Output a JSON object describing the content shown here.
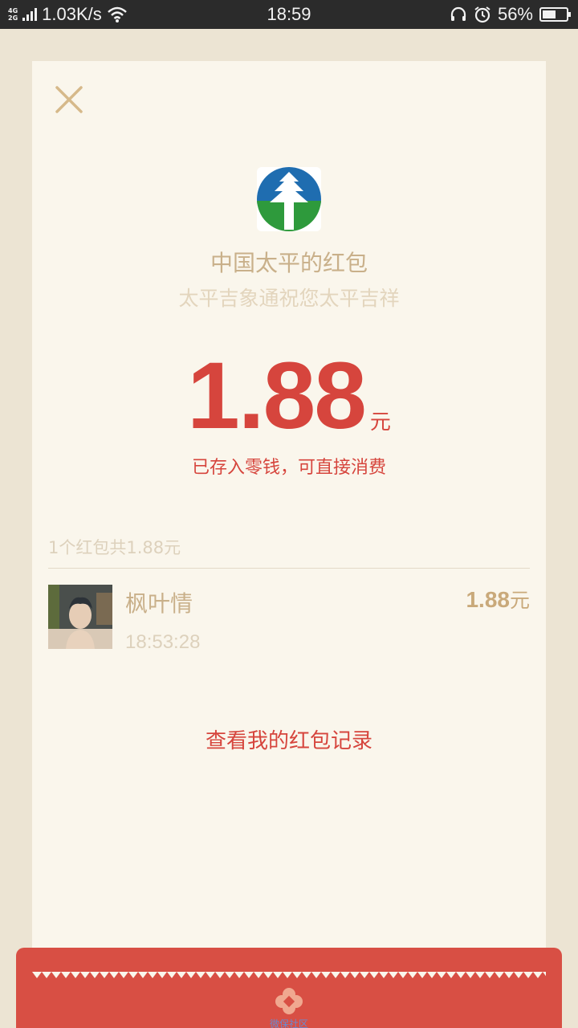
{
  "status_bar": {
    "network_types": [
      "4G",
      "2G"
    ],
    "speed": "1.03K/s",
    "time": "18:59",
    "battery_pct": "56%",
    "battery_level": 0.56,
    "icons": [
      "signal-icon",
      "wifi-icon",
      "headset-icon",
      "alarm-icon",
      "battery-icon"
    ]
  },
  "packet": {
    "sender": "中国太平的红包",
    "blessing": "太平吉象通祝您太平吉祥",
    "amount": "1.88",
    "unit": "元",
    "stored_note": "已存入零钱，可直接消费"
  },
  "summary": "1个红包共1.88元",
  "records": [
    {
      "name": "枫叶情",
      "time": "18:53:28",
      "amount": "1.88",
      "unit": "元"
    }
  ],
  "history_link": "查看我的红包记录",
  "bottom_label": "微保社区",
  "colors": {
    "accent_red": "#d6453d",
    "gold": "#c9b08a",
    "card_bg": "#faf6ec",
    "page_bg": "#ece4d3"
  }
}
